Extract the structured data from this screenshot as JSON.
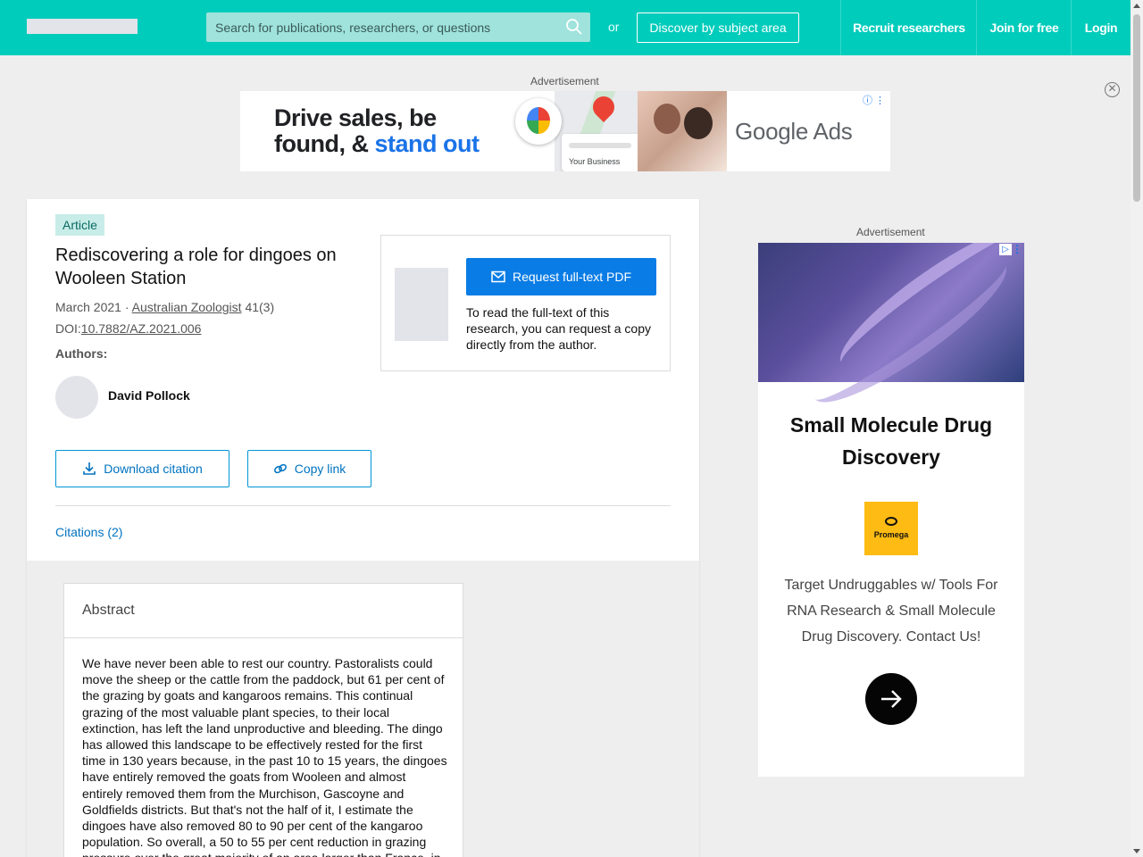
{
  "header": {
    "search_placeholder": "Search for publications, researchers, or questions",
    "or_text": "or",
    "discover_label": "Discover by subject area",
    "nav": [
      "Recruit researchers",
      "Join for free",
      "Login"
    ]
  },
  "top_ad": {
    "label": "Advertisement",
    "headline_line1": "Drive sales, be",
    "headline_line2_plain": "found, & ",
    "headline_line2_blue": "stand out",
    "card_text": "Your Business",
    "brand": "Google Ads"
  },
  "article": {
    "badge": "Article",
    "title": "Rediscovering a role for dingoes on Wooleen Station",
    "date": "March 2021",
    "separator": " · ",
    "journal": "Australian Zoologist",
    "volume": " 41(3)",
    "doi_prefix": "DOI:",
    "doi": "10.7882/AZ.2021.006",
    "authors_label": "Authors:",
    "author_name": "David Pollock",
    "download_citation": "Download citation",
    "copy_link": "Copy link",
    "citations_tab": "Citations (2)",
    "request_pdf": "Request full-text PDF",
    "request_text": "To read the full-text of this research, you can request a copy directly from the author."
  },
  "abstract": {
    "title": "Abstract",
    "text": "We have never been able to rest our country. Pastoralists could move the sheep or the cattle from the paddock, but 61 per cent of the grazing by goats and kangaroos remains. This continual grazing of the most valuable plant species, to their local extinction, has left the land unproductive and bleeding. The dingo has allowed this landscape to be effectively rested for the first time in 130 years because, in the past 10 to 15 years, the dingoes have entirely removed the goats from Wooleen and almost entirely removed them from the Murchison, Gascoyne and Goldfields districts. But that's not the half of it, I estimate the dingoes have also removed 80 to 90 per cent of the kangaroo population. So overall, a 50 to 55 per cent reduction in grazing pressure over the great majority of an area larger than France, in"
  },
  "right_ad": {
    "label": "Advertisement",
    "headline": "Small Molecule Drug Discovery",
    "brand": "Promega",
    "body": "Target Undruggables w/ Tools For RNA Research & Small Molecule Drug Discovery. Contact Us!"
  },
  "colors": {
    "header_bg": "#00ccbb",
    "primary_button": "#0a7ce5",
    "link": "#0073c0"
  },
  "icons": [
    "search-icon",
    "close-icon",
    "download-icon",
    "link-icon",
    "mail-icon",
    "arrow-right-icon"
  ]
}
